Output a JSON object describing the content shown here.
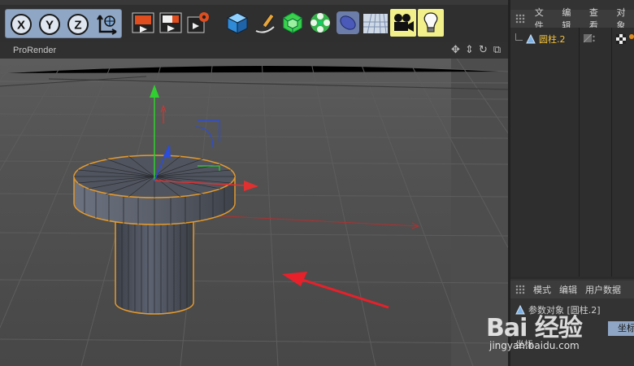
{
  "toolbar": {
    "axis_buttons": [
      "X",
      "Y",
      "Z"
    ],
    "coord_icon": "world-coordinate-icon",
    "render_icons": [
      "render-view-icon",
      "render-picture-viewer-icon",
      "render-settings-icon"
    ],
    "object_icons": [
      "cube-icon",
      "pen-spline-icon",
      "subdivision-icon",
      "cloner-icon",
      "deformer-icon",
      "floor-icon",
      "camera-icon",
      "light-icon"
    ]
  },
  "viewport": {
    "title": "ProRender",
    "nav_icons": [
      "move-view-icon",
      "zoom-view-icon",
      "rotate-view-icon",
      "maximize-view-icon"
    ]
  },
  "object_manager": {
    "tabs": [
      "文件",
      "编辑",
      "查看",
      "对象"
    ],
    "objects": [
      {
        "name": "圆柱.2",
        "selected": true
      }
    ]
  },
  "attributes": {
    "tabs": [
      "模式",
      "编辑",
      "用户数据"
    ],
    "object_label": "参数对象 [圆柱.2]",
    "active_tab": "坐标",
    "section": "坐标"
  },
  "watermark": {
    "logo": "Bai 经验",
    "url": "jingyan.baidu.com"
  },
  "colors": {
    "accent_selection": "#f5a623",
    "x_axis": "#e03030",
    "y_axis": "#30d030",
    "z_axis": "#2a4ddc",
    "annotation_arrow": "#e8202a"
  }
}
